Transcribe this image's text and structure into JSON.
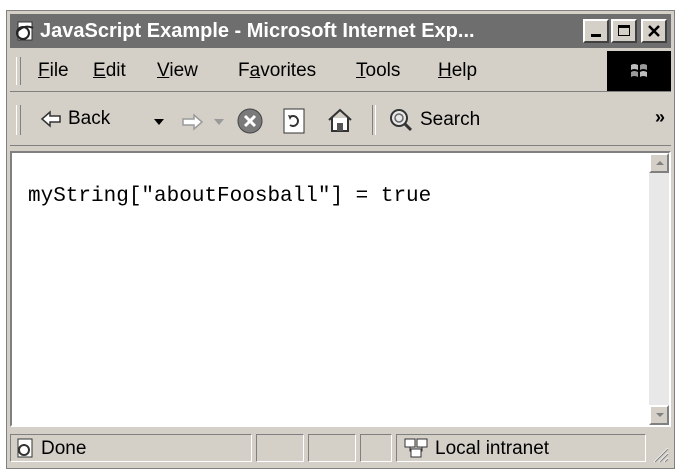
{
  "window": {
    "title": "JavaScript Example - Microsoft Internet Exp...",
    "title_icon": "ie-page-icon",
    "controls": [
      "minimize-icon",
      "maximize-icon",
      "close-icon"
    ]
  },
  "menu": {
    "file": "File",
    "edit": "Edit",
    "view": "View",
    "favorites": "Favorites",
    "tools": "Tools",
    "help": "Help",
    "brand_icon": "windows-flag-icon"
  },
  "toolbar": {
    "back": "Back",
    "search": "Search",
    "chevron": "»",
    "icons": [
      "back-arrow-icon",
      "forward-arrow-icon",
      "stop-icon",
      "refresh-icon",
      "home-icon",
      "search-icon"
    ]
  },
  "content": {
    "text": "myString[\"aboutFoosball\"] = true"
  },
  "status": {
    "text": "Done",
    "zone": "Local intranet"
  },
  "colors": {
    "chrome": "#d4d0c8",
    "titlebar": "#6e6e6e",
    "content_bg": "#ffffff"
  }
}
